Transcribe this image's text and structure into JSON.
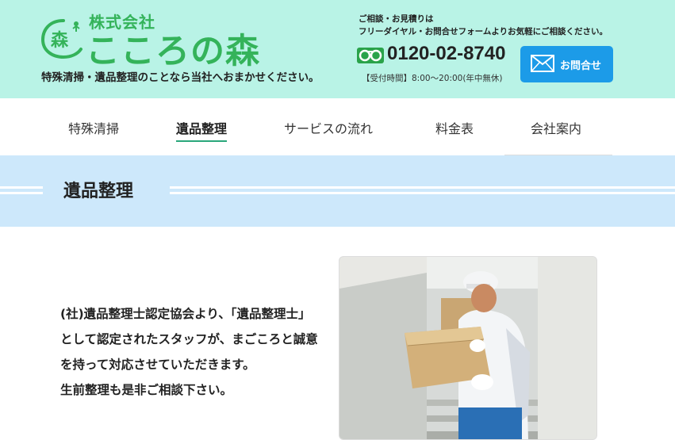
{
  "header": {
    "company_type": "株式会社",
    "company_name": "こころの森",
    "tagline": "特殊清掃・遺品整理のことなら当社へおまかせください。",
    "consult_line1": "ご相談・お見積りは",
    "consult_line2": "フリーダイヤル・お問合せフォームよりお気軽にご相談ください。",
    "phone": "0120-02-8740",
    "hours": "【受付時間】8:00～20:00(年中無休)",
    "contact_button": "お問合せ",
    "colors": {
      "header_bg": "#b9f3e6",
      "brand_green": "#34b35a",
      "button_blue": "#1c9be8"
    }
  },
  "nav": {
    "items": [
      {
        "label": "特殊清掃"
      },
      {
        "label": "遺品整理"
      },
      {
        "label": "サービスの流れ"
      },
      {
        "label": "料金表"
      },
      {
        "label": "会社案内"
      }
    ],
    "active": "遺品整理"
  },
  "page": {
    "title": "遺品整理",
    "intro_line1": "(社)遺品整理士認定協会より、「遺品整理士」として認定されたスタッフが、まごころと誠意を持って対応させていただきます。",
    "intro_line2": "生前整理も是非ご相談下さい。"
  },
  "icons": [
    "forest-logo-icon",
    "freedial-icon",
    "mail-icon"
  ]
}
